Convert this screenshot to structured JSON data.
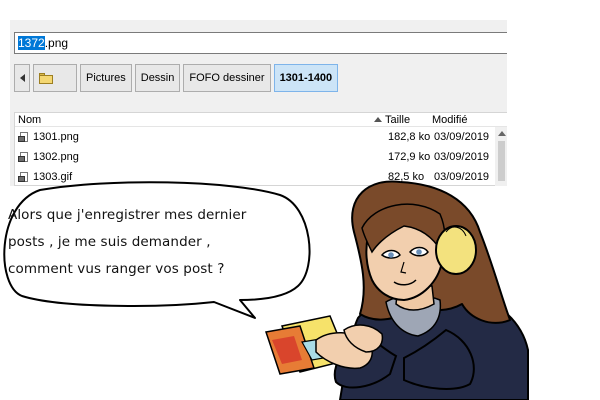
{
  "dialog": {
    "filename": {
      "selected": "1372",
      "rest": ".png"
    },
    "breadcrumbs": {
      "back_icon": "left-arrow-icon",
      "folder_icon": "folder-icon",
      "items": [
        "Pictures",
        "Dessin",
        "FOFO dessiner",
        "1301-1400"
      ]
    },
    "list": {
      "columns": {
        "name": "Nom",
        "size": "Taille",
        "modified": "Modifié"
      },
      "rows": [
        {
          "name": "1301.png",
          "size": "182,8 ko",
          "modified": "03/09/2019"
        },
        {
          "name": "1302.png",
          "size": "172,9 ko",
          "modified": "03/09/2019"
        },
        {
          "name": "1303.gif",
          "size": "82,5 ko",
          "modified": "03/09/2019"
        }
      ]
    },
    "colors": {
      "selection": "#0078d7",
      "active_crumb": "#cce4f7"
    }
  },
  "speech_bubble": {
    "lines": [
      "Alors que j'enregistrer mes dernier",
      "posts , je me suis demander ,",
      "comment vus ranger vos post ?"
    ]
  }
}
